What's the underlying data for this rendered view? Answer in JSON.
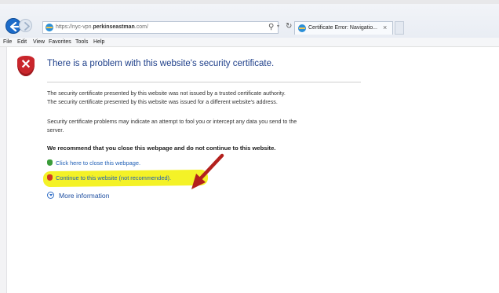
{
  "browser": {
    "address": {
      "prefix": "https://nyc-vpn.",
      "domain": "perkinseastman",
      "suffix": ".com/"
    },
    "search_glyph": "⚲",
    "dropdown_glyph": "▾",
    "refresh_glyph": "↻",
    "tab": {
      "title": "Certificate Error: Navigatio...",
      "close": "×"
    }
  },
  "menu": [
    "File",
    "Edit",
    "View",
    "Favorites",
    "Tools",
    "Help"
  ],
  "page": {
    "heading": "There is a problem with this website's security certificate.",
    "paragraph1": [
      "The security certificate presented by this website was not issued by a trusted certificate authority.",
      "The security certificate presented by this website was issued for a different website's address."
    ],
    "paragraph2": [
      "Security certificate problems may indicate an attempt to fool you or intercept any data you send to the",
      "server."
    ],
    "recommendation": "We recommend that you close this webpage and do not continue to this website.",
    "close_link": "Click here to close this webpage.",
    "continue_link": "Continue to this website (not recommended).",
    "more_info": "More information"
  },
  "annotation": {
    "highlight_color": "#f4f227",
    "arrow_color": "#b3201d"
  },
  "icons": {
    "back": "back-arrow-icon",
    "forward": "forward-arrow-icon",
    "error_shield": "red-shield-x-icon",
    "close_shield": "green-shield-icon",
    "continue_shield": "red-shield-icon",
    "expand": "expand-circle-icon"
  }
}
